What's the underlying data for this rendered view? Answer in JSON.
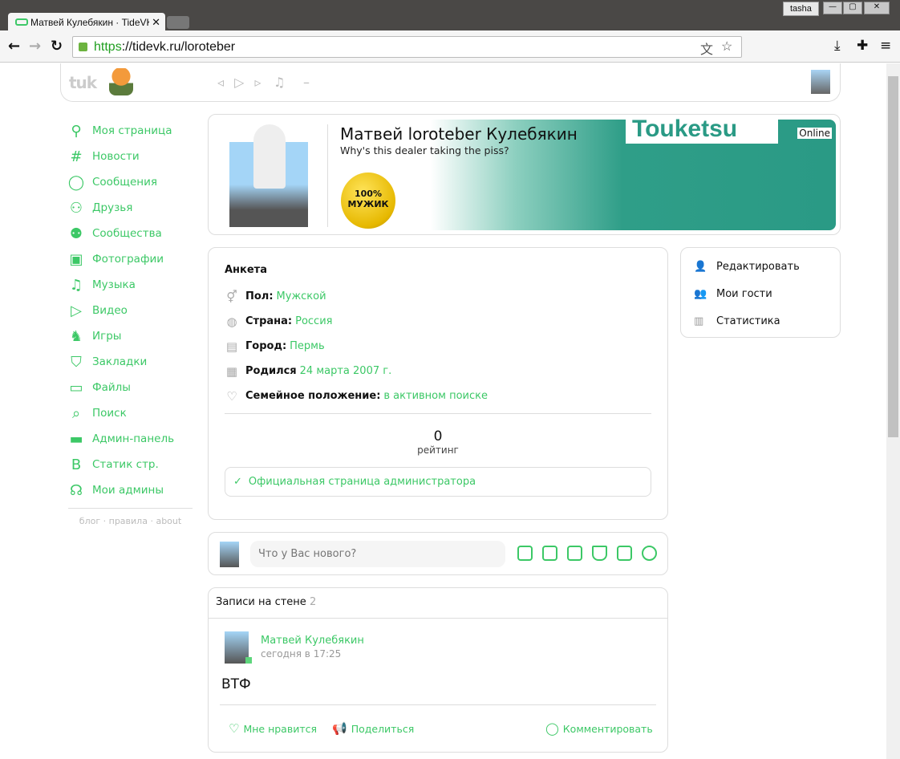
{
  "browser": {
    "tab_title": "Матвей Кулебякин · TideVK",
    "user": "tasha",
    "url_scheme": "https",
    "url_rest": "://tidevk.ru/loroteber"
  },
  "header": {
    "logo": "tuk",
    "player_controls": "◃ ▷ ▹",
    "player_track": "–"
  },
  "sidebar": {
    "items": [
      {
        "label": "Моя страница",
        "icon": "user-icon"
      },
      {
        "label": "Новости",
        "icon": "hash-icon"
      },
      {
        "label": "Сообщения",
        "icon": "chat-icon"
      },
      {
        "label": "Друзья",
        "icon": "friends-icon"
      },
      {
        "label": "Сообщества",
        "icon": "groups-icon"
      },
      {
        "label": "Фотографии",
        "icon": "photo-icon"
      },
      {
        "label": "Музыка",
        "icon": "music-icon"
      },
      {
        "label": "Видео",
        "icon": "video-icon"
      },
      {
        "label": "Игры",
        "icon": "game-icon"
      },
      {
        "label": "Закладки",
        "icon": "bookmark-icon"
      },
      {
        "label": "Файлы",
        "icon": "folder-icon"
      },
      {
        "label": "Поиск",
        "icon": "search-icon"
      },
      {
        "label": "Админ-панель",
        "icon": "admin-icon"
      },
      {
        "label": "Статик стр.",
        "icon": "static-icon"
      },
      {
        "label": "Мои админы",
        "icon": "headset-icon"
      }
    ],
    "footer": [
      "блог",
      "правила",
      "about"
    ]
  },
  "profile": {
    "name": "Матвей loroteber Кулебякин",
    "status": "Why's this dealer taking the piss?",
    "online": "Online",
    "banner_text": "Touketsu",
    "badge_line1": "100%",
    "badge_line2": "МУЖИК"
  },
  "info": {
    "title": "Анкета",
    "rows": [
      {
        "label": "Пол:",
        "value": "Мужской"
      },
      {
        "label": "Страна:",
        "value": "Россия"
      },
      {
        "label": "Город:",
        "value": "Пермь"
      },
      {
        "label": "Родился",
        "value": "24 марта 2007 г."
      },
      {
        "label": "Семейное положение:",
        "value": "в активном поиске"
      }
    ],
    "rating_value": "0",
    "rating_label": "рейтинг",
    "official": "Официальная страница администратора"
  },
  "actions": [
    "Редактировать",
    "Мои гости",
    "Статистика"
  ],
  "compose": {
    "placeholder": "Что у Вас нового?"
  },
  "wall": {
    "title": "Записи на стене",
    "count": "2",
    "post": {
      "author": "Матвей Кулебякин",
      "time": "сегодня в 17:25",
      "text": "ВТФ",
      "like": "Мне нравится",
      "share": "Поделиться",
      "comment": "Комментировать"
    }
  },
  "colors": {
    "accent": "#3cc866"
  }
}
